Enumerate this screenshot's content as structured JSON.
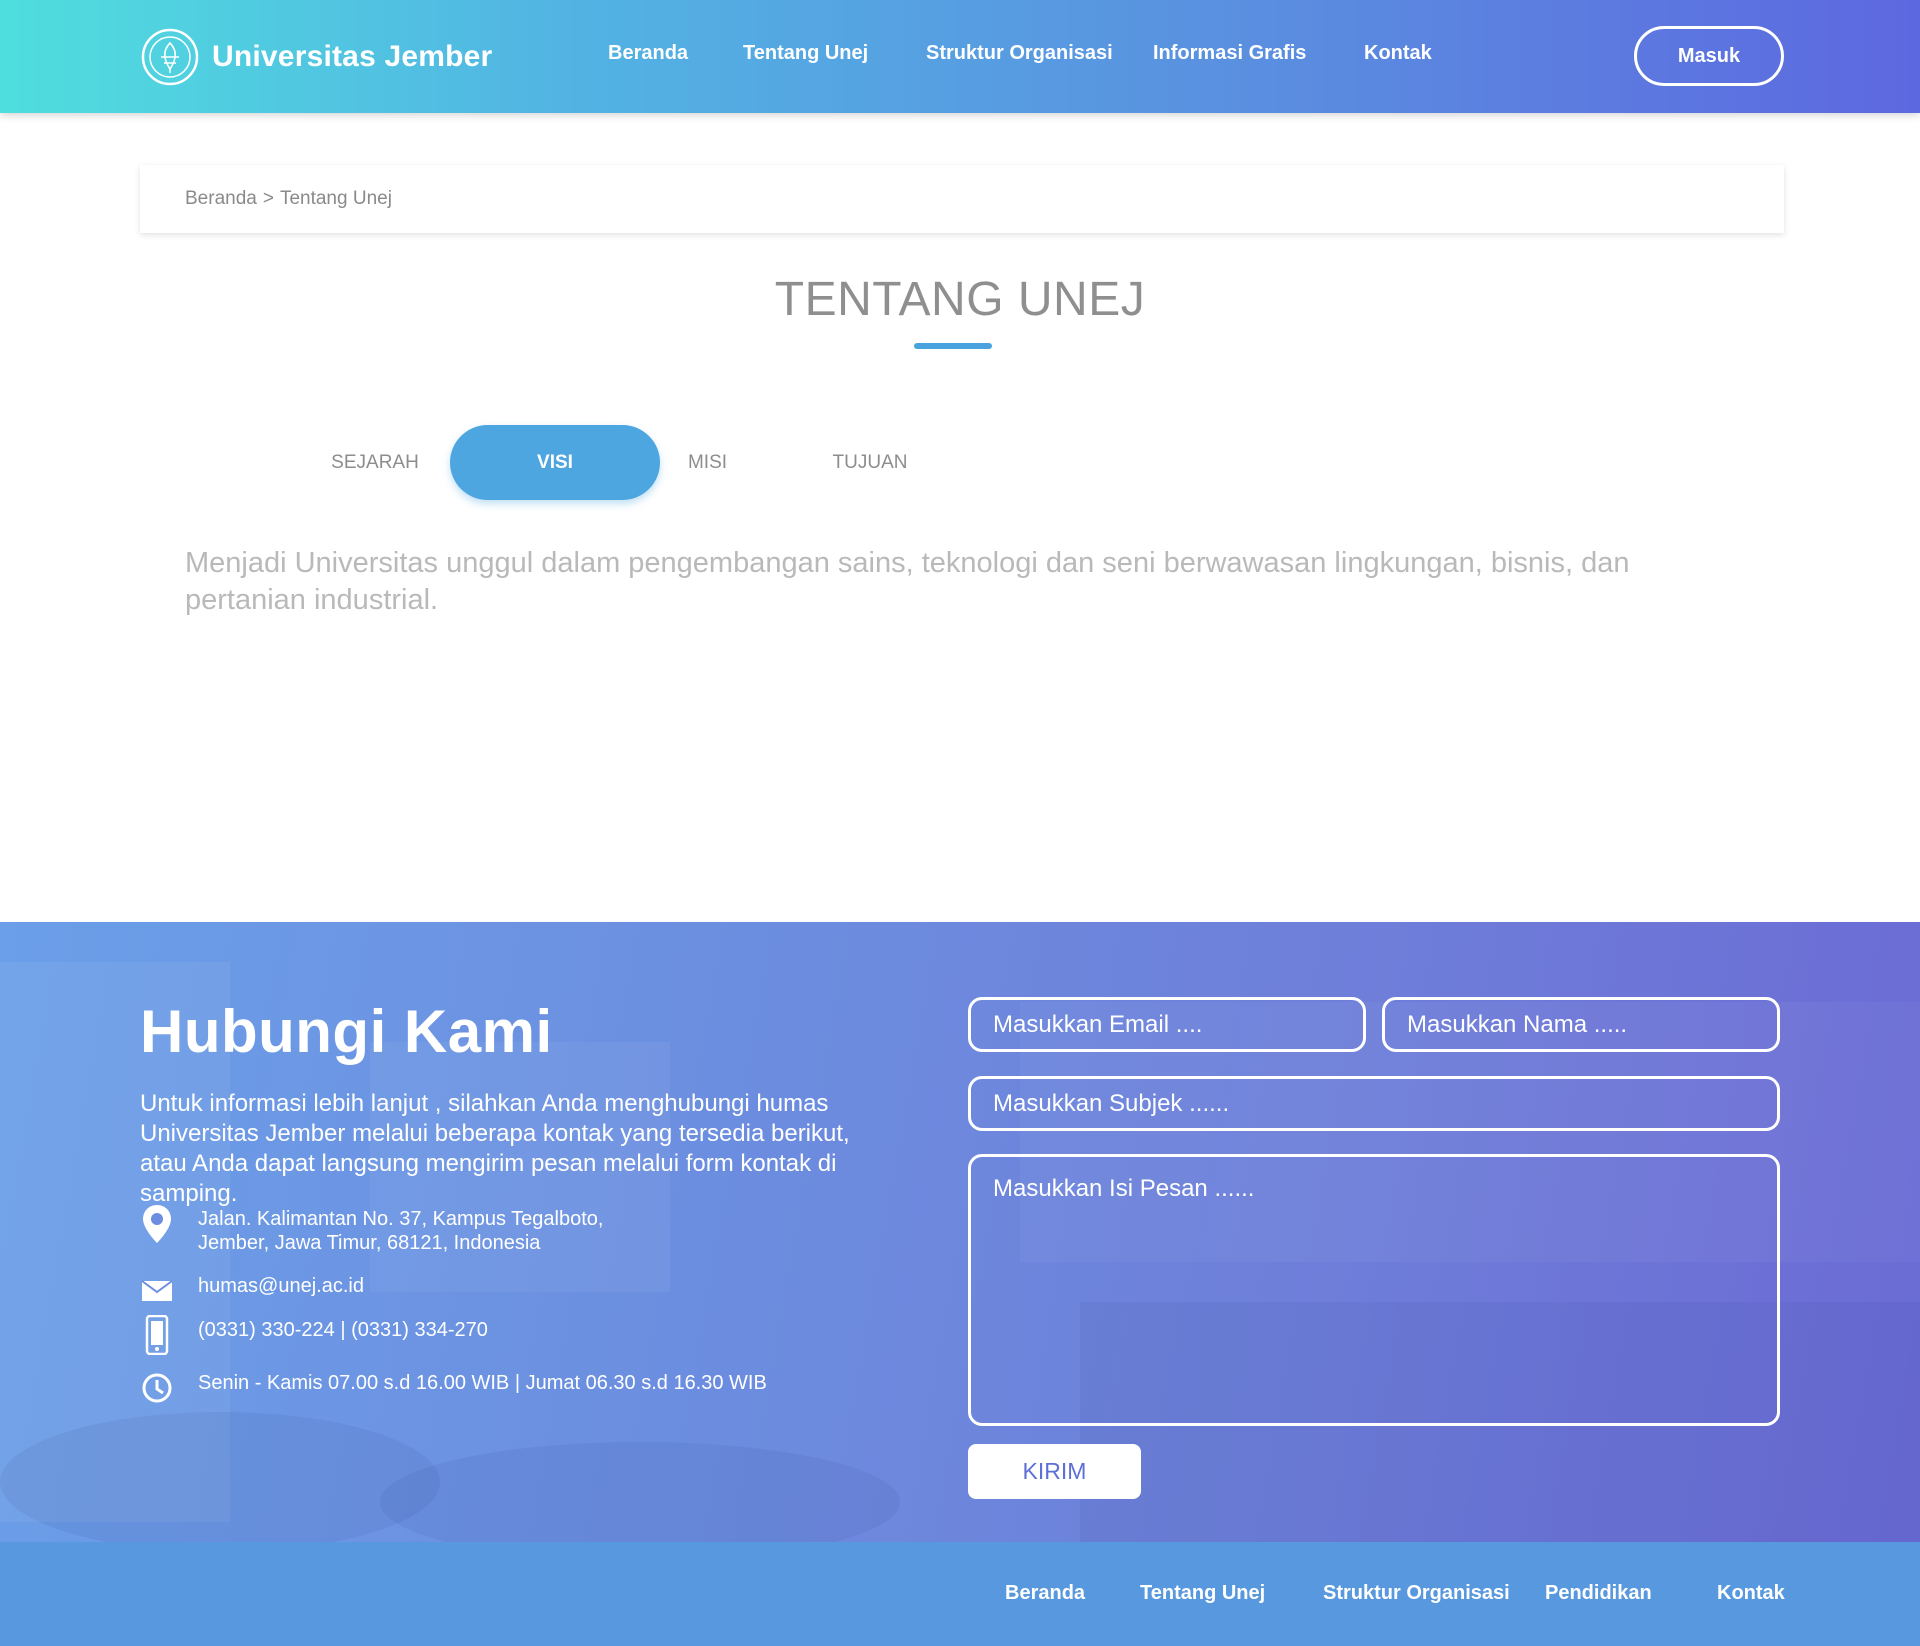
{
  "header": {
    "brand_name": "Universitas Jember",
    "logo_icon": "university-seal-logo",
    "nav": [
      "Beranda",
      "Tentang Unej",
      "Struktur Organisasi",
      "Informasi Grafis",
      "Kontak"
    ],
    "login_label": "Masuk"
  },
  "breadcrumb": {
    "home": "Beranda",
    "separator": ">",
    "current": "Tentang Unej"
  },
  "main": {
    "title": "TENTANG UNEJ",
    "tabs": [
      {
        "label": "SEJARAH",
        "active": false
      },
      {
        "label": "VISI",
        "active": true
      },
      {
        "label": "MISI",
        "active": false
      },
      {
        "label": "TUJUAN",
        "active": false
      }
    ],
    "content": "Menjadi Universitas unggul dalam pengembangan sains, teknologi dan seni berwawasan lingkungan, bisnis, dan pertanian industrial."
  },
  "contact": {
    "title": "Hubungi Kami",
    "description": "Untuk informasi lebih lanjut , silahkan Anda menghubungi humas Universitas Jember melalui beberapa kontak yang tersedia berikut, atau Anda dapat langsung mengirim pesan melalui form kontak di samping.",
    "address_line1": "Jalan. Kalimantan No. 37, Kampus Tegalboto,",
    "address_line2": "Jember, Jawa Timur, 68121, Indonesia",
    "email": "humas@unej.ac.id",
    "phone": "(0331) 330-224 | (0331) 334-270",
    "hours": "Senin - Kamis 07.00 s.d 16.00 WIB | Jumat 06.30 s.d 16.30 WIB",
    "form": {
      "email_placeholder": "Masukkan Email ....",
      "name_placeholder": "Masukkan Nama .....",
      "subject_placeholder": "Masukkan Subjek ......",
      "message_placeholder": "Masukkan Isi Pesan ......",
      "submit_label": "KIRIM"
    }
  },
  "footer": {
    "nav": [
      "Beranda",
      "Tentang Unej",
      "Struktur Organisasi",
      "Pendidikan",
      "Kontak"
    ]
  },
  "colors": {
    "header_gradient_start": "#4fdede",
    "header_gradient_end": "#5d68e0",
    "accent": "#4ea6e0",
    "footer": "#5898de",
    "submit_text": "#5e6fd6"
  }
}
